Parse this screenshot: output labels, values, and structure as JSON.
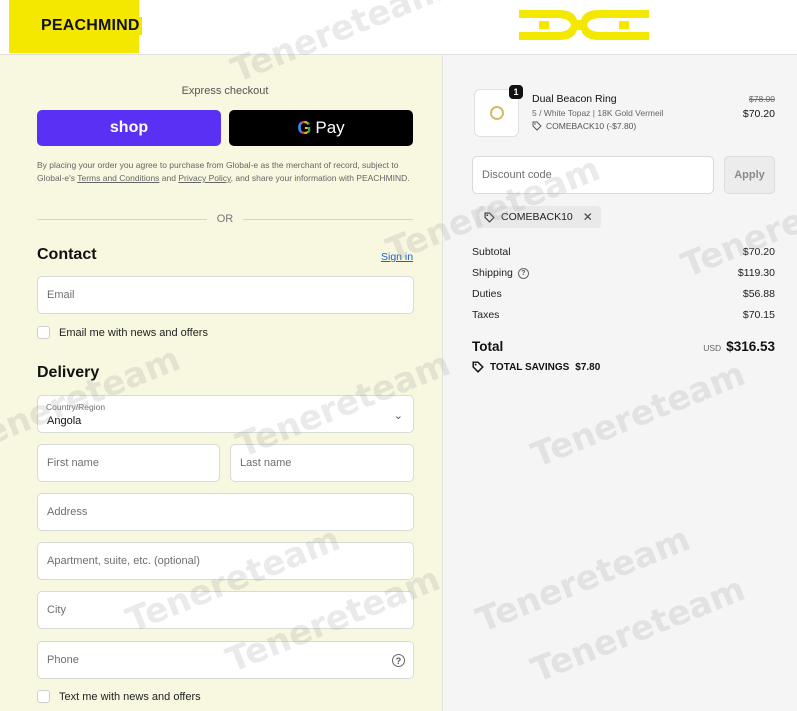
{
  "header": {
    "brand": "PEACHMIND"
  },
  "express": {
    "title": "Express checkout",
    "shop_label": "shop",
    "gpay_g": "G",
    "gpay_label": "Pay"
  },
  "legal": {
    "part1": "By placing your order you agree to purchase from Global-e as the merchant of record, subject to Global-e's ",
    "terms_link": "Terms and Conditions",
    "part2": " and ",
    "privacy_link": "Privacy Policy",
    "part3": ", and share your information with PEACHMIND."
  },
  "divider": "OR",
  "contact": {
    "heading": "Contact",
    "signin": "Sign in",
    "email_placeholder": "Email",
    "news_label": "Email me with news and offers"
  },
  "delivery": {
    "heading": "Delivery",
    "country_label": "Country/Region",
    "country_value": "Angola",
    "first_name": "First name",
    "last_name": "Last name",
    "address": "Address",
    "apartment": "Apartment, suite, etc. (optional)",
    "city": "City",
    "phone": "Phone",
    "text_label": "Text me with news and offers"
  },
  "order": {
    "item": {
      "quantity": "1",
      "name": "Dual Beacon Ring",
      "variant": "5 / White Topaz | 18K Gold Vermeil",
      "discount": "COMEBACK10 (-$7.80)",
      "price_original": "$78.00",
      "price_final": "$70.20"
    },
    "discount_placeholder": "Discount code",
    "apply_label": "Apply",
    "applied_code": "COMEBACK10",
    "subtotal_label": "Subtotal",
    "subtotal_value": "$70.20",
    "shipping_label": "Shipping",
    "shipping_value": "$119.30",
    "duties_label": "Duties",
    "duties_value": "$56.88",
    "taxes_label": "Taxes",
    "taxes_value": "$70.15",
    "total_label": "Total",
    "currency": "USD",
    "total_value": "$316.53",
    "savings_label": "TOTAL SAVINGS",
    "savings_value": "$7.80"
  },
  "watermark": "Tenereteam",
  "colors": {
    "brand_yellow": "#f4e800",
    "shop_purple": "#5a31f4",
    "left_bg": "#f8f7df"
  }
}
